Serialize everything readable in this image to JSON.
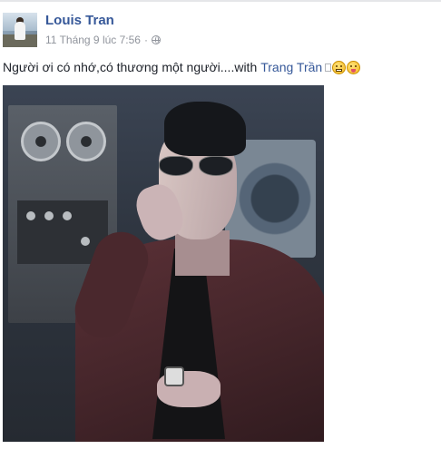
{
  "post": {
    "author_name": "Louis Tran",
    "timestamp": "11 Tháng 9 lúc 7:56",
    "separator": "·",
    "status_text": "Người ơi có nhớ,có thương một người....with",
    "tagged_name": "Trang Trần",
    "audience_icon": "globe-icon"
  },
  "photo": {
    "description_icon": "post-photo"
  },
  "colors": {
    "link": "#365899",
    "meta": "#90949c",
    "text": "#1d2129"
  }
}
